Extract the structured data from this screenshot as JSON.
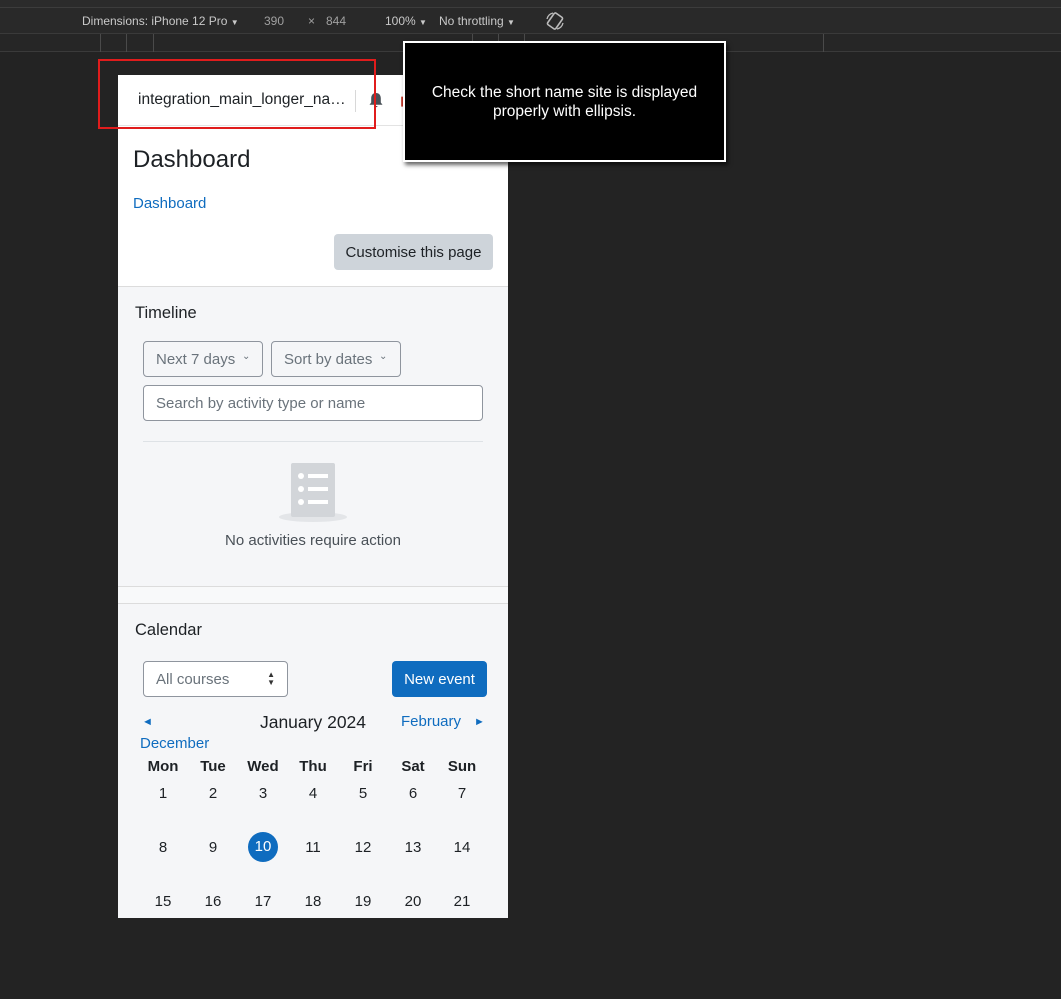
{
  "devtools": {
    "dimensions_label": "Dimensions: iPhone 12 Pro",
    "width": "390",
    "times": "×",
    "height": "844",
    "zoom": "100%",
    "throttling": "No throttling",
    "rotate_icon": "rotate-device-icon"
  },
  "navbar": {
    "site_name": "integration_main_longer_name_site",
    "bell_icon": "bell-icon"
  },
  "page": {
    "title": "Dashboard",
    "breadcrumb": "Dashboard",
    "customise_label": "Customise this page"
  },
  "timeline": {
    "title": "Timeline",
    "filter_label": "Next 7 days",
    "sort_label": "Sort by dates",
    "search_placeholder": "Search by activity type or name",
    "empty_text": "No activities require action"
  },
  "calendar": {
    "title": "Calendar",
    "courses_label": "All courses",
    "new_event_label": "New event",
    "prev_month": "December",
    "current_month": "January 2024",
    "next_month": "February",
    "weekdays": [
      "Mon",
      "Tue",
      "Wed",
      "Thu",
      "Fri",
      "Sat",
      "Sun"
    ],
    "weeks": [
      [
        "1",
        "2",
        "3",
        "4",
        "5",
        "6",
        "7"
      ],
      [
        "8",
        "9",
        "10",
        "11",
        "12",
        "13",
        "14"
      ],
      [
        "15",
        "16",
        "17",
        "18",
        "19",
        "20",
        "21"
      ]
    ],
    "today": "10"
  },
  "annotation": {
    "note": "Check the short name site is displayed properly with ellipsis.",
    "highlight_color": "#e01c1c"
  },
  "colors": {
    "primary": "#0f6cbf",
    "background": "#232323"
  }
}
